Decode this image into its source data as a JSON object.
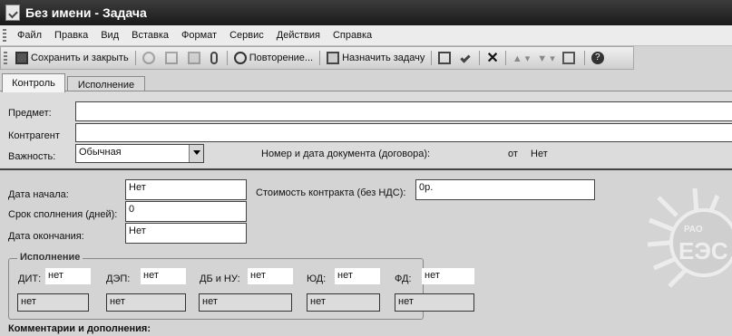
{
  "window": {
    "title": "Без имени - Задача"
  },
  "menu": {
    "items": [
      {
        "label": "Файл"
      },
      {
        "label": "Правка"
      },
      {
        "label": "Вид"
      },
      {
        "label": "Вставка"
      },
      {
        "label": "Формат"
      },
      {
        "label": "Сервис"
      },
      {
        "label": "Действия"
      },
      {
        "label": "Справка"
      }
    ]
  },
  "toolbar": {
    "save_close": "Сохранить и закрыть",
    "recurrence": "Повторение...",
    "assign_task": "Назначить задачу"
  },
  "tabs": [
    {
      "label": "Контроль",
      "active": true
    },
    {
      "label": "Исполнение",
      "active": false
    }
  ],
  "form": {
    "subject_label": "Предмет:",
    "subject_value": "",
    "contractor_label": "Контрагент",
    "contractor_value": "",
    "importance_label": "Важность:",
    "importance_value": "Обычная",
    "docnum_label": "Номер и дата документа (договора):",
    "docnum_from": "от",
    "docnum_value": "Нет",
    "start_label": "Дата начала:",
    "start_value": "Нет",
    "term_label": "Срок сполнения (дней):",
    "term_value": "0",
    "end_label": "Дата окончания:",
    "end_value": "Нет",
    "cost_label": "Стоимость контракта (без НДС):",
    "cost_value": "0р."
  },
  "execution": {
    "title": "Исполнение",
    "depts": [
      {
        "label": "ДИТ:",
        "value": "нет",
        "status": "нет"
      },
      {
        "label": "ДЭП:",
        "value": "нет",
        "status": "нет"
      },
      {
        "label": "ДБ и НУ:",
        "value": "нет",
        "status": "нет"
      },
      {
        "label": "ЮД:",
        "value": "нет",
        "status": "нет"
      },
      {
        "label": "ФД:",
        "value": "нет",
        "status": "нет"
      }
    ]
  },
  "comments_label": "Комментарии и дополнения:",
  "logo": {
    "text_top": "РАО",
    "text_main": "ЕЭС"
  }
}
